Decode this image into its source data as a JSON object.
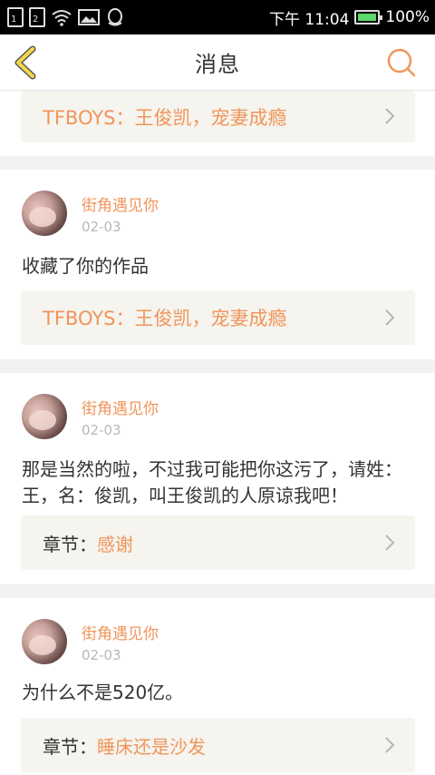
{
  "status_bar": {
    "sim1": "1",
    "sim2": "2",
    "time": "下午 11:04",
    "battery": "100%"
  },
  "nav": {
    "title": "消息"
  },
  "items": [
    {
      "ref_title": "TFBOYS：王俊凯，宠妻成瘾"
    },
    {
      "username": "街角遇见你",
      "date": "02-03",
      "message": "收藏了你的作品",
      "ref_title": "TFBOYS：王俊凯，宠妻成瘾"
    },
    {
      "username": "街角遇见你",
      "date": "02-03",
      "message": "那是当然的啦，不过我可能把你这污了，请姓：王，名：俊凯，叫王俊凯的人原谅我吧！",
      "ref_prefix": "章节：",
      "ref_chapter": "感谢"
    },
    {
      "username": "街角遇见你",
      "date": "02-03",
      "message": "为什么不是520亿。",
      "ref_prefix": "章节：",
      "ref_chapter": "睡床还是沙发"
    }
  ],
  "colors": {
    "accent": "#f0955a",
    "back_arrow": "#f5d84a",
    "ref_bg": "#f5f4ee"
  },
  "icons": {
    "back": "chevron-left-icon",
    "search": "search-icon",
    "chevron": "chevron-right-icon"
  }
}
